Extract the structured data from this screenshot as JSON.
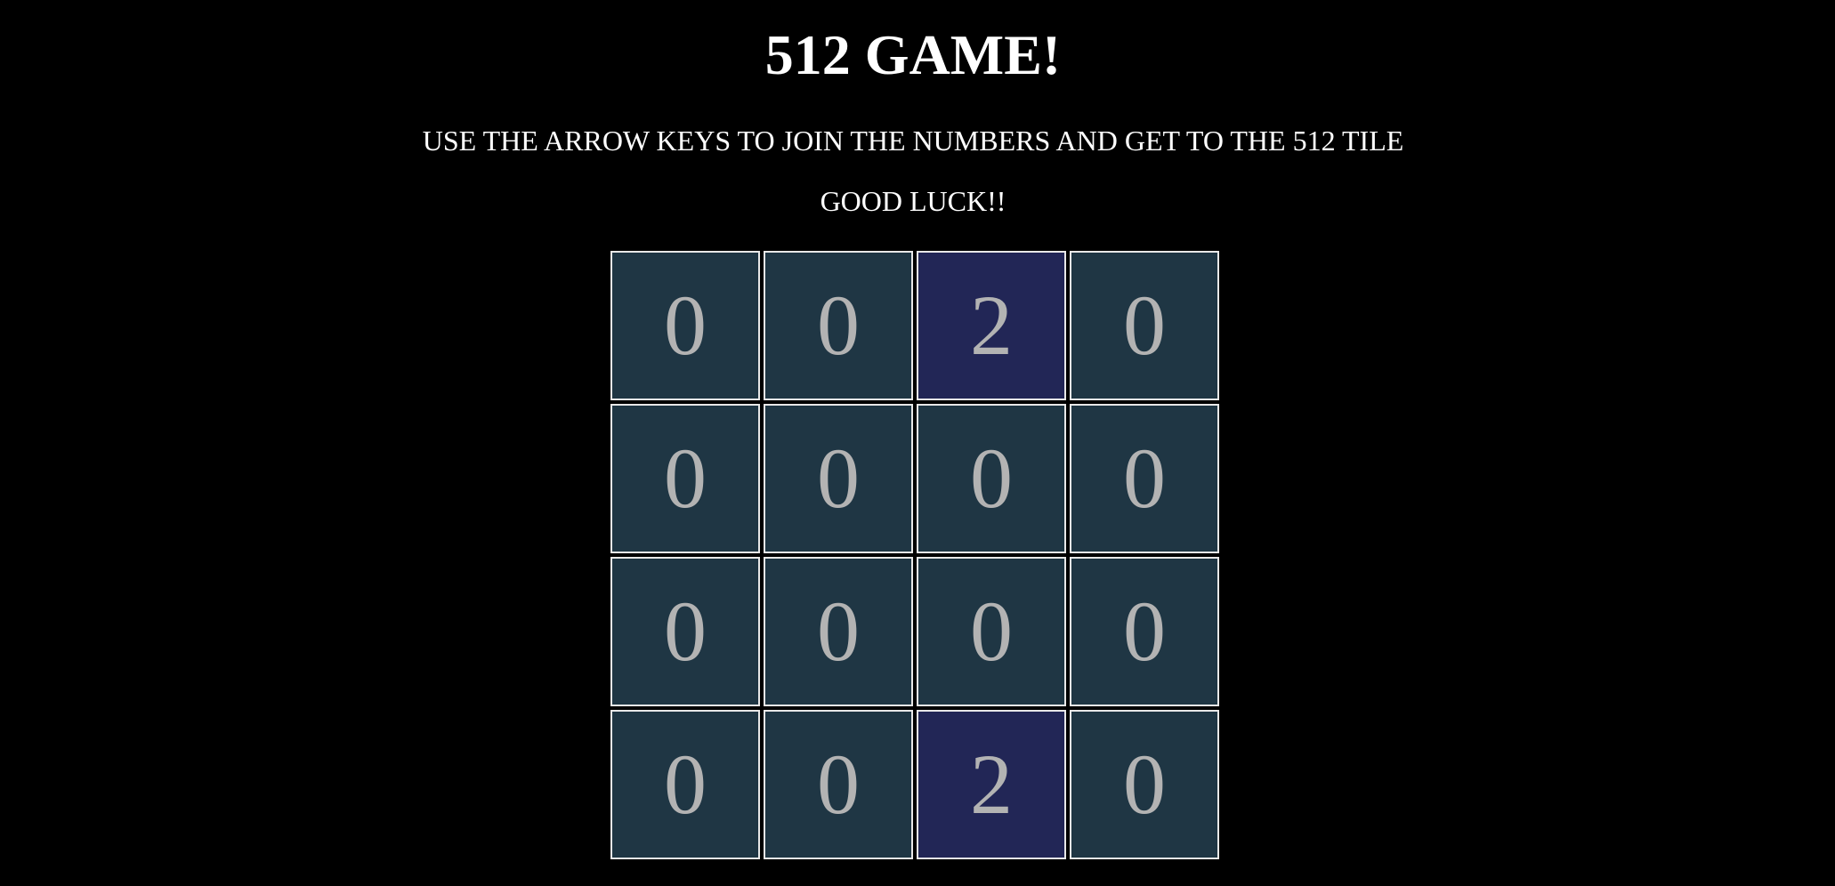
{
  "header": {
    "title": "512 GAME!",
    "instructions": "USE THE ARROW KEYS TO JOIN THE NUMBERS AND GET TO THE 512 TILE",
    "luck": "GOOD LUCK!!"
  },
  "board": {
    "rows": [
      [
        "0",
        "0",
        "2",
        "0"
      ],
      [
        "0",
        "0",
        "0",
        "0"
      ],
      [
        "0",
        "0",
        "0",
        "0"
      ],
      [
        "0",
        "0",
        "2",
        "0"
      ]
    ]
  },
  "colors": {
    "background": "#000000",
    "empty_tile": "#1f3644",
    "tile_2": "#222656",
    "tile_border": "#e8e8e8",
    "tile_text": "#b3b3b3"
  }
}
